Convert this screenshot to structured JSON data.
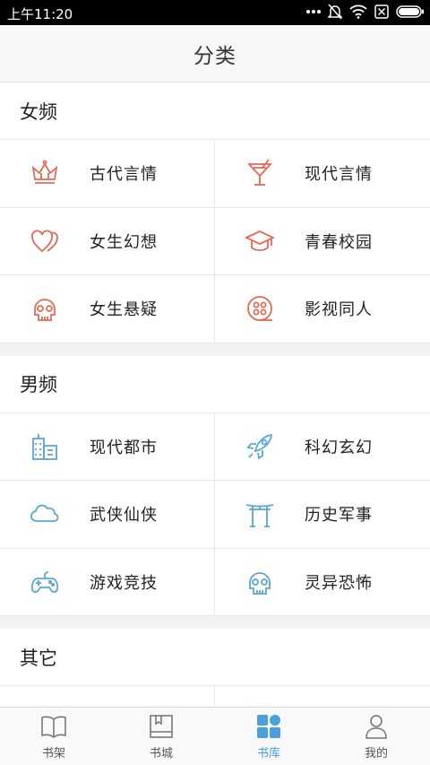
{
  "status_bar": {
    "time": "上午11:20",
    "icons": [
      "dots-icon",
      "bell-muted-icon",
      "wifi-icon",
      "sim-icon",
      "battery-icon"
    ]
  },
  "title": "分类",
  "sections": [
    {
      "header": "女频",
      "accent": "#e36a55",
      "items": [
        {
          "label": "古代言情",
          "icon": "crown-icon"
        },
        {
          "label": "现代言情",
          "icon": "cocktail-icon"
        },
        {
          "label": "女生幻想",
          "icon": "hearts-icon"
        },
        {
          "label": "青春校园",
          "icon": "graduation-cap-icon"
        },
        {
          "label": "女生悬疑",
          "icon": "skull-icon"
        },
        {
          "label": "影视同人",
          "icon": "film-reel-icon"
        }
      ]
    },
    {
      "header": "男频",
      "accent": "#5aa6d6",
      "items": [
        {
          "label": "现代都市",
          "icon": "buildings-icon"
        },
        {
          "label": "科幻玄幻",
          "icon": "rocket-icon"
        },
        {
          "label": "武侠仙侠",
          "icon": "cloud-icon"
        },
        {
          "label": "历史军事",
          "icon": "gate-icon"
        },
        {
          "label": "游戏竞技",
          "icon": "gamepad-icon"
        },
        {
          "label": "灵异恐怖",
          "icon": "skull-icon"
        }
      ]
    },
    {
      "header": "其它",
      "items": []
    }
  ],
  "tabs": [
    {
      "label": "书架",
      "icon": "open-book-icon",
      "active": false
    },
    {
      "label": "书城",
      "icon": "book-icon",
      "active": false
    },
    {
      "label": "书库",
      "icon": "grid-icon",
      "active": true
    },
    {
      "label": "我的",
      "icon": "user-icon",
      "active": false
    }
  ],
  "colors": {
    "active_tab": "#4a9fde",
    "female_accent": "#e36a55",
    "male_accent": "#5aa6d6"
  }
}
